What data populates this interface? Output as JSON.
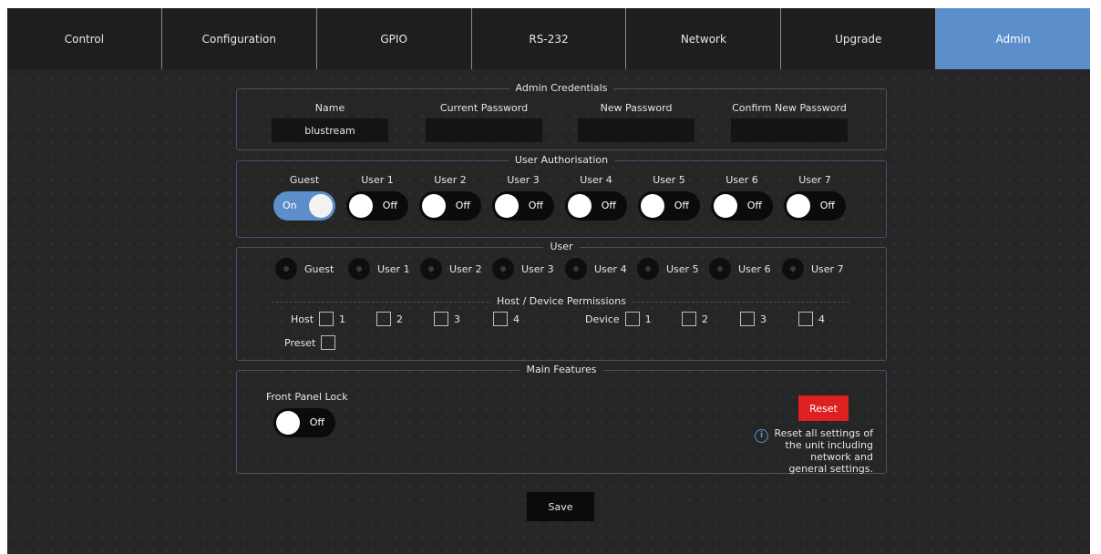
{
  "nav": {
    "tabs": [
      {
        "label": "Control"
      },
      {
        "label": "Configuration"
      },
      {
        "label": "GPIO"
      },
      {
        "label": "RS-232"
      },
      {
        "label": "Network"
      },
      {
        "label": "Upgrade"
      },
      {
        "label": "Admin",
        "active": true
      }
    ]
  },
  "admin_credentials": {
    "legend": "Admin Credentials",
    "name_label": "Name",
    "name_value": "blustream",
    "current_password_label": "Current Password",
    "current_password_value": "",
    "new_password_label": "New Password",
    "new_password_value": "",
    "confirm_password_label": "Confirm New Password",
    "confirm_password_value": ""
  },
  "user_authorisation": {
    "legend": "User Authorisation",
    "users": [
      {
        "label": "Guest",
        "state": "On"
      },
      {
        "label": "User 1",
        "state": "Off"
      },
      {
        "label": "User 2",
        "state": "Off"
      },
      {
        "label": "User 3",
        "state": "Off"
      },
      {
        "label": "User 4",
        "state": "Off"
      },
      {
        "label": "User 5",
        "state": "Off"
      },
      {
        "label": "User 6",
        "state": "Off"
      },
      {
        "label": "User 7",
        "state": "Off"
      }
    ]
  },
  "user": {
    "legend": "User",
    "options": [
      "Guest",
      "User 1",
      "User 2",
      "User 3",
      "User 4",
      "User 5",
      "User 6",
      "User 7"
    ],
    "permissions_legend": "Host / Device Permissions",
    "host_label": "Host",
    "device_label": "Device",
    "preset_label": "Preset",
    "host_numbers": [
      "1",
      "2",
      "3",
      "4"
    ],
    "device_numbers": [
      "1",
      "2",
      "3",
      "4"
    ]
  },
  "main_features": {
    "legend": "Main Features",
    "front_panel_lock_label": "Front Panel Lock",
    "front_panel_lock_state": "Off",
    "reset_label": "Reset",
    "reset_info": "Reset all settings of the unit including network and general settings.",
    "info_icon": "info-icon"
  },
  "save_label": "Save",
  "colors": {
    "accent": "#5b8ecb",
    "reset": "#dd2020",
    "background": "#262626",
    "section_border": "#3c5471"
  }
}
